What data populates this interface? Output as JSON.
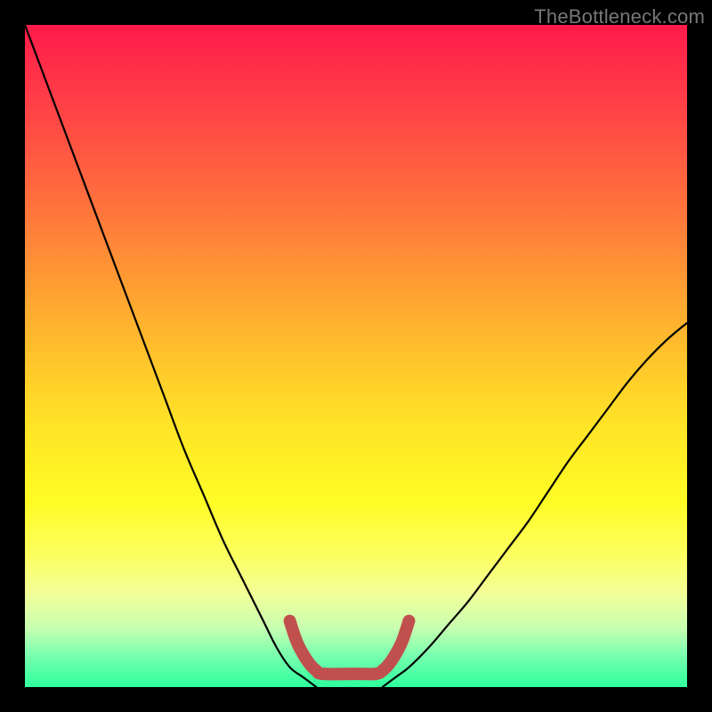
{
  "watermark": "TheBottleneck.com",
  "chart_data": {
    "type": "line",
    "title": "",
    "xlabel": "",
    "ylabel": "",
    "xlim": [
      0,
      100
    ],
    "ylim": [
      0,
      100
    ],
    "series": [
      {
        "name": "left-falling-curve",
        "x": [
          0,
          3,
          6,
          9,
          12,
          15,
          18,
          21,
          24,
          27,
          30,
          33,
          36,
          38,
          40,
          42,
          44
        ],
        "y": [
          100,
          92,
          84,
          76,
          68,
          60,
          52,
          44,
          36,
          29,
          22,
          16,
          10,
          6,
          3,
          1.5,
          0
        ]
      },
      {
        "name": "right-rising-curve",
        "x": [
          54,
          56,
          58,
          61,
          64,
          67,
          70,
          73,
          76,
          79,
          82,
          85,
          88,
          91,
          94,
          97,
          100
        ],
        "y": [
          0,
          1.5,
          3,
          6,
          9.5,
          13,
          17,
          21,
          25,
          29.5,
          34,
          38,
          42,
          46,
          49.5,
          52.5,
          55
        ]
      },
      {
        "name": "bottom-red-u",
        "x": [
          40,
          41,
          42,
          43,
          44,
          45,
          50,
          53,
          54,
          55,
          56,
          57,
          58
        ],
        "y": [
          10,
          7,
          5,
          3.5,
          2.5,
          2,
          2,
          2,
          2.5,
          3.5,
          5,
          7,
          10
        ]
      }
    ],
    "gradient_background": {
      "top_color": "#ff1a4a",
      "mid_colors": [
        "#ff6a3e",
        "#ffe327",
        "#fcff5f"
      ],
      "bottom_color": "#2dff9d"
    }
  }
}
